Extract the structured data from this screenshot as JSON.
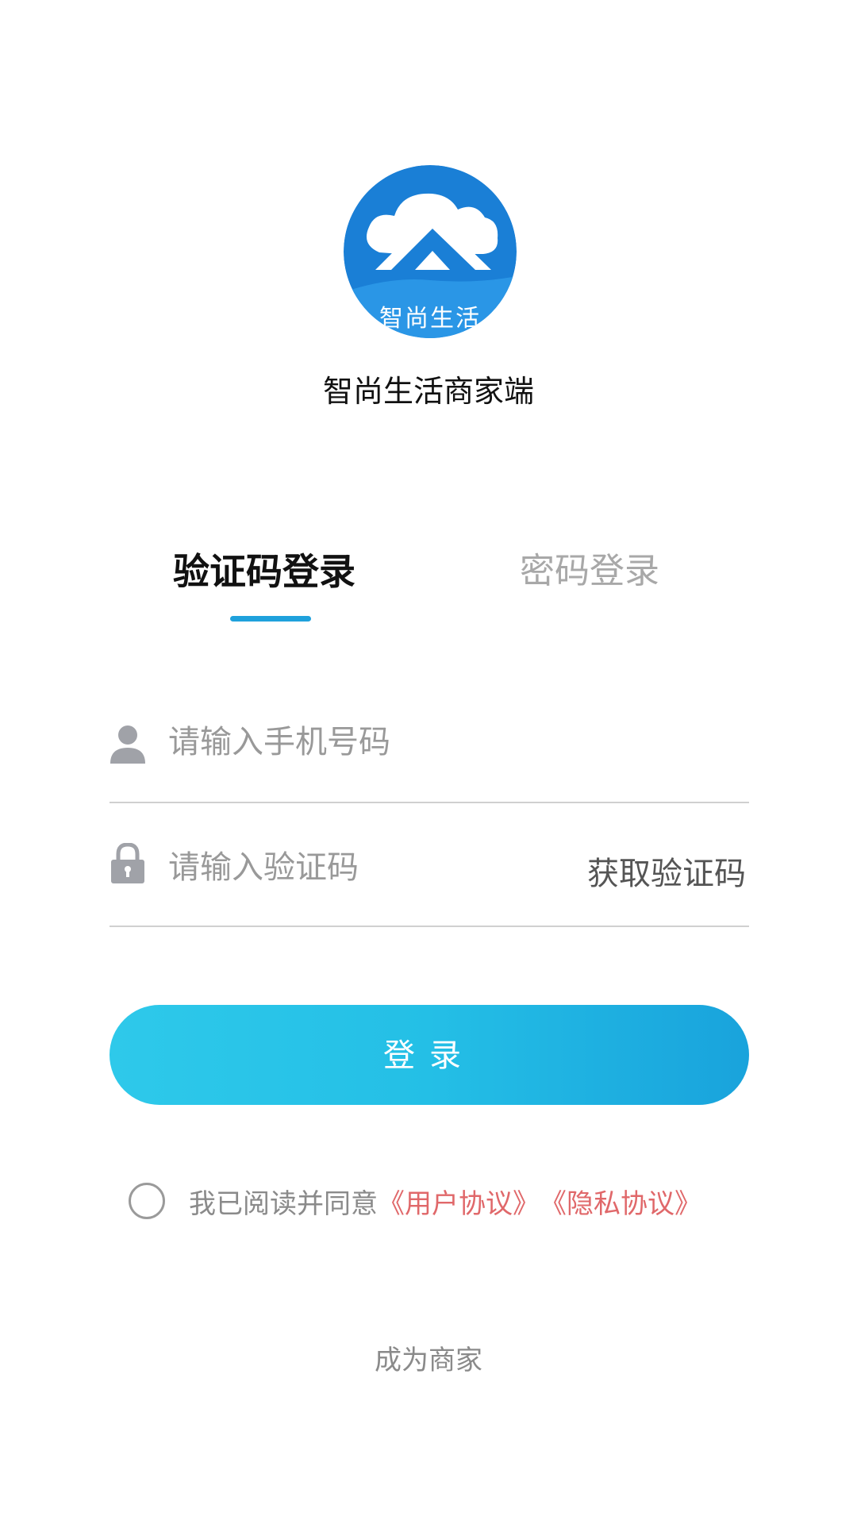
{
  "logo": {
    "text": "智尚生活",
    "icon": "cloud-house-logo-icon",
    "colors": {
      "circle": "#1a7fd6",
      "wave": "#2a96e6",
      "roof": "#ffffff"
    }
  },
  "app_name": "智尚生活商家端",
  "tabs": [
    {
      "label": "验证码登录",
      "active": true
    },
    {
      "label": "密码登录",
      "active": false
    }
  ],
  "form": {
    "phone": {
      "icon": "user-icon",
      "placeholder": "请输入手机号码",
      "value": ""
    },
    "code": {
      "icon": "lock-icon",
      "placeholder": "请输入验证码",
      "value": "",
      "get_code_label": "获取验证码"
    }
  },
  "login_button": {
    "label": "登录"
  },
  "agreement": {
    "checked": false,
    "text": "我已阅读并同意",
    "user_agreement": "《用户协议》",
    "privacy_policy": "《隐私协议》"
  },
  "become_merchant": "成为商家",
  "colors": {
    "accent": "#1fa1dc",
    "link": "#e0686a",
    "button_start": "#2ec9ea",
    "button_end": "#19a3dc"
  }
}
